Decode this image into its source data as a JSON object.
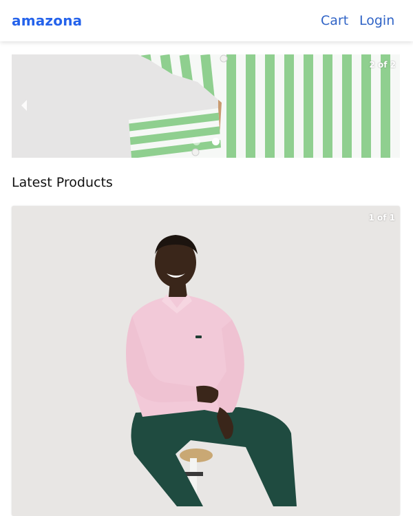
{
  "header": {
    "brand": "amazona",
    "nav": {
      "cart_label": "Cart",
      "login_label": "Login"
    },
    "colors": {
      "brand": "#2563eb",
      "link": "#2f63c6"
    }
  },
  "carousel": {
    "slide_counter": "2 of 2",
    "prev_icon": "chevron-left-icon",
    "dots_count": 2,
    "active_dot": 2
  },
  "products": {
    "heading": "Latest Products",
    "items": [
      {
        "image_counter": "1 of 1"
      }
    ]
  }
}
